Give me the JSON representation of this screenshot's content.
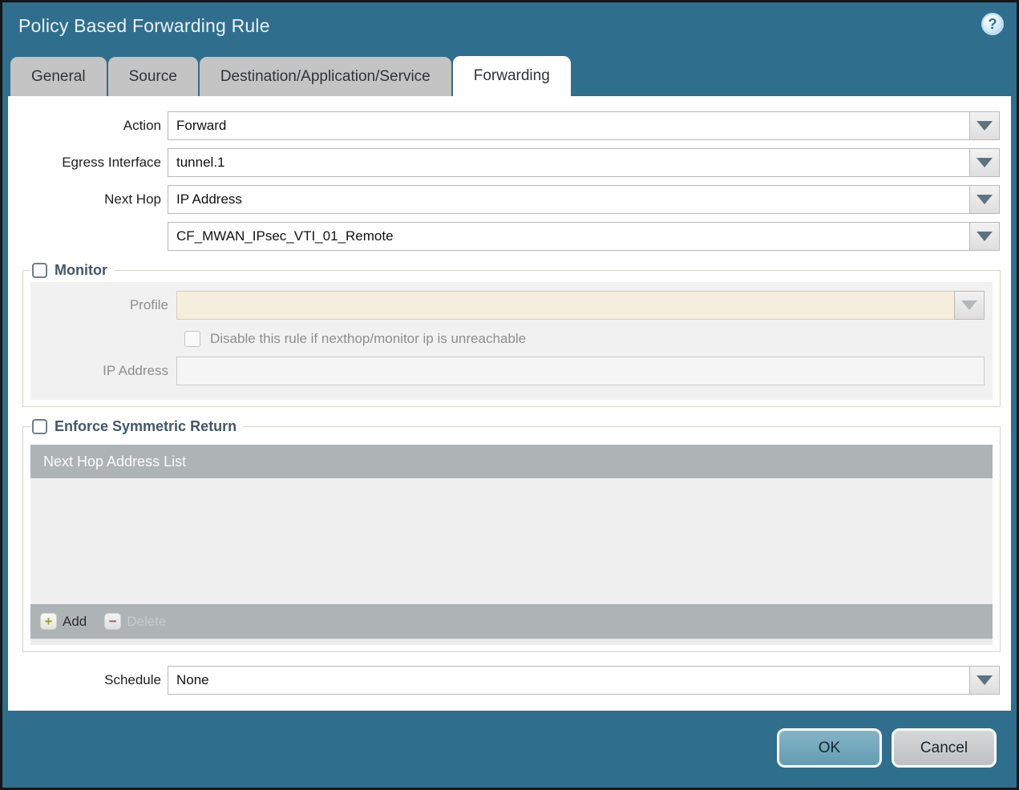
{
  "dialog": {
    "title": "Policy Based Forwarding Rule",
    "help_glyph": "?"
  },
  "tabs": [
    {
      "label": "General",
      "active": false
    },
    {
      "label": "Source",
      "active": false
    },
    {
      "label": "Destination/Application/Service",
      "active": false
    },
    {
      "label": "Forwarding",
      "active": true
    }
  ],
  "form": {
    "action": {
      "label": "Action",
      "value": "Forward"
    },
    "egress_interface": {
      "label": "Egress Interface",
      "value": "tunnel.1"
    },
    "next_hop": {
      "label": "Next Hop",
      "value": "IP Address"
    },
    "next_hop_address": {
      "value": "CF_MWAN_IPsec_VTI_01_Remote"
    },
    "schedule": {
      "label": "Schedule",
      "value": "None"
    }
  },
  "monitor": {
    "legend": "Monitor",
    "checked": false,
    "profile": {
      "label": "Profile",
      "value": ""
    },
    "disable_rule": {
      "label": "Disable this rule if nexthop/monitor ip is unreachable",
      "checked": false
    },
    "ip_address": {
      "label": "IP Address",
      "value": ""
    }
  },
  "symmetric_return": {
    "legend": "Enforce Symmetric Return",
    "checked": false,
    "table_header": "Next Hop Address List",
    "rows": [],
    "add_label": "Add",
    "add_glyph": "+",
    "delete_label": "Delete",
    "delete_glyph": "−",
    "delete_enabled": false
  },
  "footer": {
    "ok_label": "OK",
    "cancel_label": "Cancel"
  },
  "colors": {
    "titlebar_teal": "#306e8e",
    "inactive_tab_gray": "#c4c4c4",
    "active_tab_white": "#ffffff",
    "disabled_field_cream": "#f5eedd",
    "panel_gray": "#f1f1f1",
    "table_header_gray": "#aeb3b6",
    "ok_button_teal": "#71a8bc",
    "cancel_button_gray": "#c9cacc",
    "add_icon_green": "#97a139",
    "delete_icon_red": "#a9565c"
  }
}
